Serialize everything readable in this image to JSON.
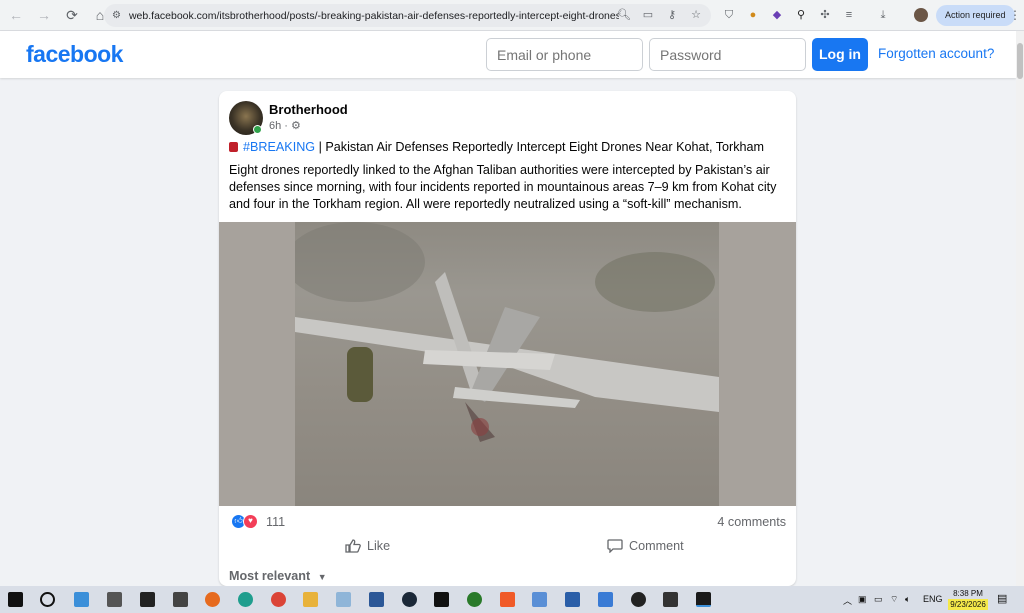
{
  "browser": {
    "url": "web.facebook.com/itsbrotherhood/posts/-breaking-pakistan-air-defenses-reportedly-intercept-eight-drones-near-k...",
    "action_required": "Action required",
    "icons": [
      "back-icon",
      "forward-icon",
      "reload-icon",
      "home-icon",
      "site-info-icon",
      "zoom-icon",
      "cast-icon",
      "password-icon",
      "bookmark-star-icon",
      "extension-icons",
      "download-icon",
      "profile-avatar",
      "menu-dots-icon"
    ]
  },
  "header": {
    "logo": "facebook",
    "email_placeholder": "Email or phone",
    "password_placeholder": "Password",
    "login_label": "Log in",
    "forgot_label": "Forgotten account?"
  },
  "post": {
    "page_name": "Brotherhood",
    "time": "6h",
    "privacy_icon": "gear-icon",
    "hashtag": "#BREAKING",
    "headline": " | Pakistan Air Defenses Reportedly Intercept Eight Drones Near Kohat, Torkham",
    "body": "Eight drones reportedly linked to the Afghan Taliban authorities were intercepted by Pakistan’s air defenses since morning, with four incidents reported in mountainous areas 7–9 km from Kohat city and four in the Torkham region. All were reportedly neutralized using a “soft-kill” mechanism.",
    "reaction_count": "111",
    "comments": "4 comments",
    "like_label": "Like",
    "comment_label": "Comment",
    "most_relevant": "Most relevant"
  },
  "taskbar": {
    "tray_lang": "ENG",
    "time": "8:38 PM",
    "date": "9/23/2026"
  },
  "colors": {
    "brand": "#1877f2",
    "background": "#f0f2f5",
    "online": "#31a24c"
  }
}
